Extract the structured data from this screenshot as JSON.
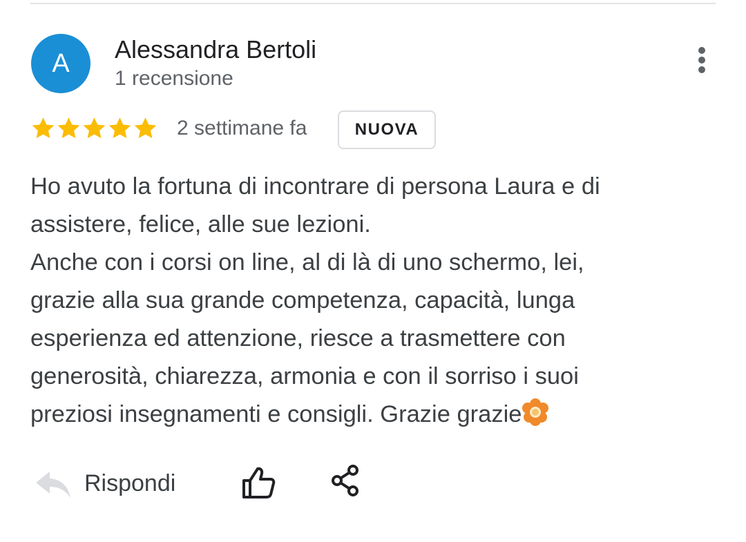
{
  "review": {
    "author": {
      "initial": "A",
      "name": "Alessandra Bertoli",
      "review_count": "1 recensione"
    },
    "rating": 5,
    "rating_max": 5,
    "time_ago": "2 settimane fa",
    "badge": "NUOVA",
    "text_lines": [
      "Ho avuto la fortuna di incontrare di persona Laura e di",
      "assistere, felice, alle sue lezioni.",
      "Anche con i corsi on line, al di là di uno schermo, lei,",
      "grazie alla sua grande competenza, capacità, lunga",
      "esperienza ed attenzione, riesce a trasmettere con",
      "generosità, chiarezza, armonia e con il sorriso i suoi",
      "preziosi insegnamenti e consigli. Grazie grazie"
    ],
    "emoji": "flower-emoji"
  },
  "actions": {
    "reply_label": "Rispondi",
    "reply_icon": "reply-arrow-icon",
    "like_icon": "thumbs-up-icon",
    "share_icon": "share-icon",
    "more_icon": "more-vert-icon"
  },
  "colors": {
    "avatar_bg": "#1a8fd6",
    "star": "#fbbc04",
    "muted_text": "#5f6368",
    "body_text": "#3c4043"
  }
}
